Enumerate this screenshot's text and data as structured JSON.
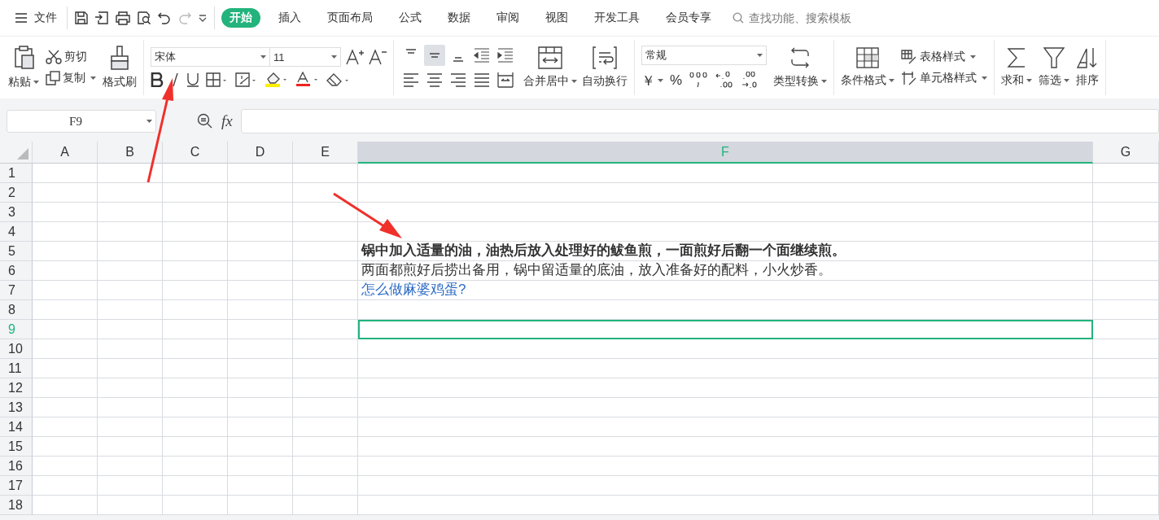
{
  "menu_bar": {
    "file_label": "文件",
    "tabs": [
      {
        "label": "开始",
        "selected": true
      },
      {
        "label": "插入",
        "selected": false
      },
      {
        "label": "页面布局",
        "selected": false
      },
      {
        "label": "公式",
        "selected": false
      },
      {
        "label": "数据",
        "selected": false
      },
      {
        "label": "审阅",
        "selected": false
      },
      {
        "label": "视图",
        "selected": false
      },
      {
        "label": "开发工具",
        "selected": false
      },
      {
        "label": "会员专享",
        "selected": false
      }
    ],
    "search": {
      "placeholder": "查找功能、搜索模板"
    }
  },
  "ribbon": {
    "clipboard": {
      "paste": "粘贴",
      "cut": "剪切",
      "copy": "复制",
      "format_painter": "格式刷"
    },
    "font": {
      "name": "宋体",
      "size": "11"
    },
    "alignment": {
      "vertical": [
        {
          "selected": false
        },
        {
          "selected": true
        },
        {
          "selected": false
        }
      ],
      "merge": "合并居中",
      "wrap": "自动换行"
    },
    "number": {
      "format": "常规",
      "currency": "￥",
      "percent": "%",
      "type_convert": "类型转换"
    },
    "styles": {
      "conditional": "条件格式",
      "table_style": "表格样式",
      "cell_style": "单元格样式"
    },
    "editing": {
      "sum": "求和",
      "filter": "筛选",
      "sort": "排序"
    }
  },
  "formula_bar": {
    "name_box": "F9",
    "fx": "fx"
  },
  "sheet": {
    "columns": [
      {
        "label": "A",
        "selected": false
      },
      {
        "label": "B",
        "selected": false
      },
      {
        "label": "C",
        "selected": false
      },
      {
        "label": "D",
        "selected": false
      },
      {
        "label": "E",
        "selected": false
      },
      {
        "label": "F",
        "selected": true
      },
      {
        "label": "G",
        "selected": false
      }
    ],
    "rows": [
      {
        "label": "1",
        "selected": false
      },
      {
        "label": "2",
        "selected": false
      },
      {
        "label": "3",
        "selected": false
      },
      {
        "label": "4",
        "selected": false
      },
      {
        "label": "5",
        "selected": false,
        "text": "锅中加入适量的油，油热后放入处理好的鲅鱼煎，一面煎好后翻一个面继续煎。",
        "kind": "bold"
      },
      {
        "label": "6",
        "selected": false,
        "text": "两面都煎好后捞出备用，锅中留适量的底油，放入准备好的配料，小火炒香。",
        "kind": "plain"
      },
      {
        "label": "7",
        "selected": false,
        "text": "怎么做麻婆鸡蛋?",
        "kind": "link"
      },
      {
        "label": "8",
        "selected": false
      },
      {
        "label": "9",
        "selected": true
      },
      {
        "label": "10",
        "selected": false
      },
      {
        "label": "11",
        "selected": false
      },
      {
        "label": "12",
        "selected": false
      },
      {
        "label": "13",
        "selected": false
      },
      {
        "label": "14",
        "selected": false
      },
      {
        "label": "15",
        "selected": false
      },
      {
        "label": "16",
        "selected": false
      },
      {
        "label": "17",
        "selected": false
      },
      {
        "label": "18",
        "selected": false
      }
    ]
  }
}
